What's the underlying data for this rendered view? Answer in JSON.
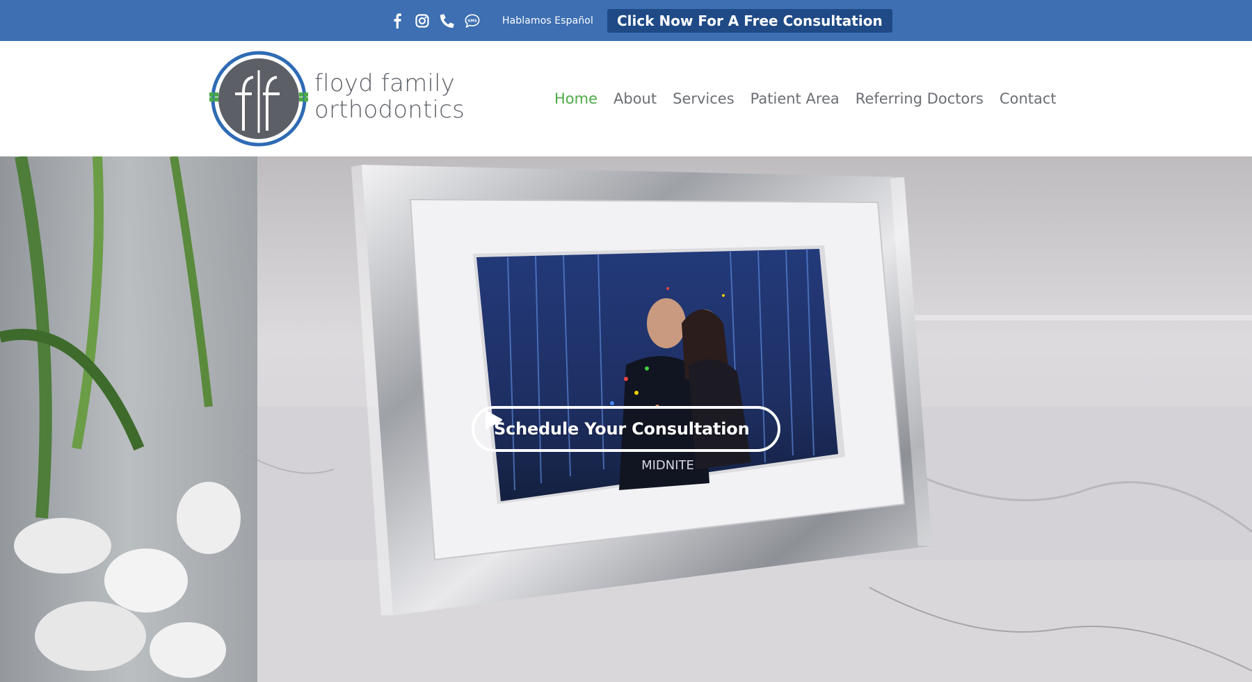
{
  "topbar": {
    "social_icons": [
      "facebook-icon",
      "instagram-icon",
      "phone-icon",
      "sms-icon"
    ],
    "sms_label": "SMS",
    "spanish_label": "Hablamos Español",
    "consult_button": "Click Now For A Free Consultation"
  },
  "header": {
    "logo": {
      "line1": "floyd family",
      "line2": "orthodontics"
    },
    "nav": [
      {
        "label": "Home",
        "active": true
      },
      {
        "label": "About",
        "active": false
      },
      {
        "label": "Services",
        "active": false
      },
      {
        "label": "Patient Area",
        "active": false
      },
      {
        "label": "Referring Doctors",
        "active": false
      },
      {
        "label": "Contact",
        "active": false
      }
    ]
  },
  "hero": {
    "cta_label": "Schedule Your Consultation",
    "cta_icon": "play-icon",
    "photo_caption": "MIDNITE"
  },
  "colors": {
    "topbar_bg": "#3d6fb2",
    "consult_button_bg": "#1f4a86",
    "nav_active": "#4caa46",
    "nav_default": "#6b6e73",
    "logo_ring": "#2f6bb5",
    "logo_green": "#4caa46",
    "logo_gray": "#5c6066"
  }
}
